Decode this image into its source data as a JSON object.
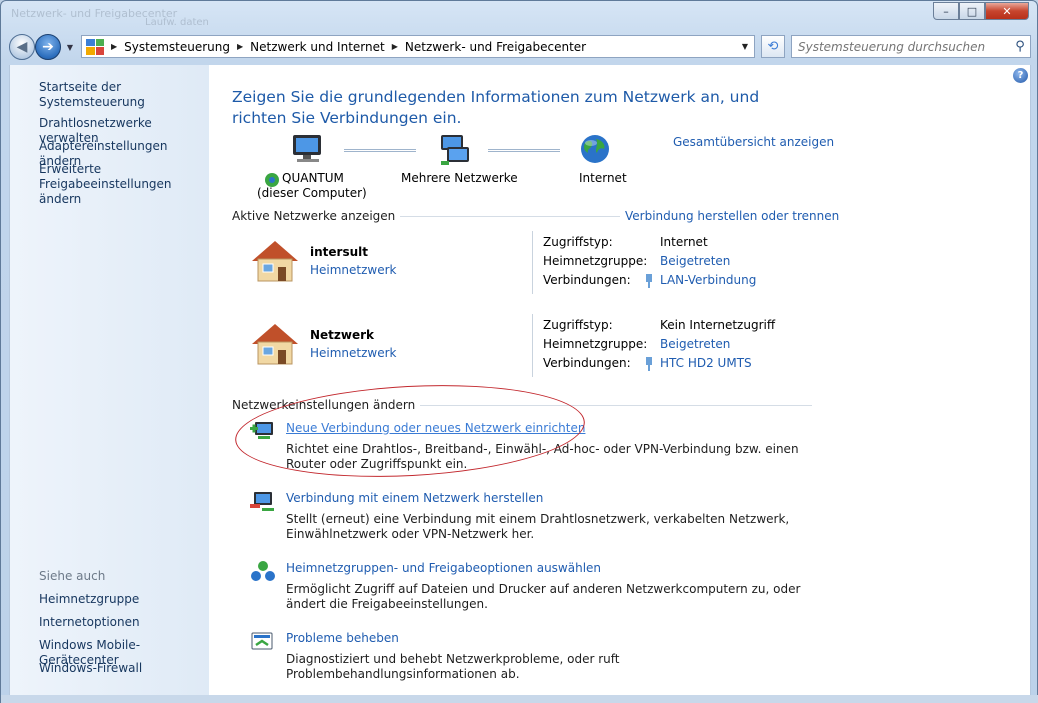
{
  "window": {
    "ghost_title": "Netzwerk- und Freigabecenter",
    "ghost_sub": "Laufw. daten",
    "min_glyph": "–",
    "max_glyph": "□",
    "close_glyph": "✕"
  },
  "nav": {
    "back_glyph": "◀",
    "forward_glyph": "➔",
    "dropdown_glyph": "▼",
    "breadcrumb": [
      "Systemsteuerung",
      "Netzwerk und Internet",
      "Netzwerk- und Freigabecenter"
    ],
    "crumb_sep": "▶",
    "refresh_glyph": "⟲",
    "search_placeholder": "Systemsteuerung durchsuchen",
    "search_glyph": "⚲"
  },
  "left_pane": {
    "home": "Startseite der Systemsteuerung",
    "links": [
      "Drahtlosnetzwerke verwalten",
      "Adaptereinstellungen ändern",
      "Erweiterte",
      "Freigabeeinstellungen ändern"
    ],
    "see_also_title": "Siehe auch",
    "see_also": [
      "Heimnetzgruppe",
      "Internetoptionen",
      "Windows Mobile-Gerätecenter",
      "Windows-Firewall"
    ]
  },
  "main": {
    "help_glyph": "?",
    "headline": "Zeigen Sie die grundlegenden Informationen zum Netzwerk an, und richten Sie Verbindungen ein.",
    "full_map_link": "Gesamtübersicht anzeigen",
    "topology": {
      "computer_name": "QUANTUM",
      "computer_sub": "(dieser Computer)",
      "middle": "Mehrere Netzwerke",
      "internet": "Internet"
    },
    "active_title": "Aktive Netzwerke anzeigen",
    "connect_link": "Verbindung herstellen oder trennen",
    "networks": [
      {
        "name": "intersult",
        "type": "Heimnetzwerk",
        "access_key": "Zugriffstyp:",
        "access_val": "Internet",
        "homegroup_key": "Heimnetzgruppe:",
        "homegroup_val": "Beigetreten",
        "conn_key": "Verbindungen:",
        "conn_val": "LAN-Verbindung"
      },
      {
        "name": "Netzwerk",
        "type": "Heimnetzwerk",
        "access_key": "Zugriffstyp:",
        "access_val": "Kein Internetzugriff",
        "homegroup_key": "Heimnetzgruppe:",
        "homegroup_val": "Beigetreten",
        "conn_key": "Verbindungen:",
        "conn_val": "HTC HD2 UMTS"
      }
    ],
    "settings_title": "Netzwerkeinstellungen ändern",
    "tasks": [
      {
        "link": "Neue Verbindung oder neues Netzwerk einrichten",
        "desc": "Richtet eine Drahtlos-, Breitband-, Einwähl-, Ad-hoc- oder VPN-Verbindung bzw. einen Router oder Zugriffspunkt ein."
      },
      {
        "link": "Verbindung mit einem Netzwerk herstellen",
        "desc": "Stellt (erneut) eine Verbindung mit einem Drahtlosnetzwerk, verkabelten Netzwerk, Einwählnetzwerk oder VPN-Netzwerk her."
      },
      {
        "link": "Heimnetzgruppen- und Freigabeoptionen auswählen",
        "desc": "Ermöglicht Zugriff auf Dateien und Drucker auf anderen Netzwerkcomputern zu, oder ändert die Freigabeeinstellungen."
      },
      {
        "link": "Probleme beheben",
        "desc": "Diagnostiziert und behebt Netzwerkprobleme, oder ruft Problembehandlungsinformationen ab."
      }
    ]
  }
}
